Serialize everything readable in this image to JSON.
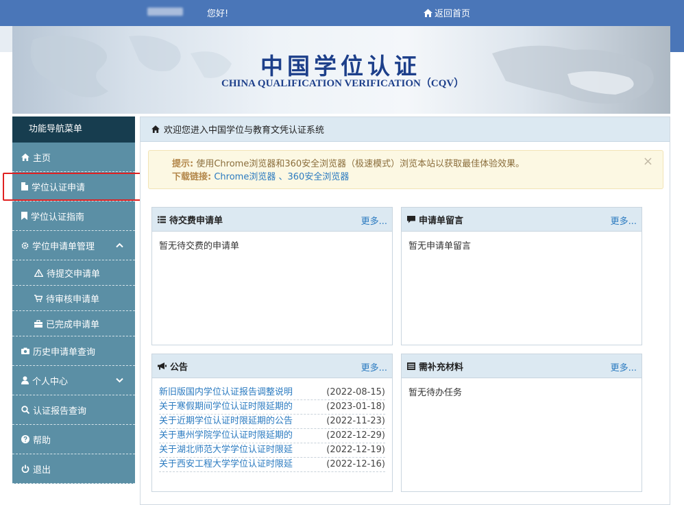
{
  "topbar": {
    "greeting": "您好!",
    "home_label": "返回首页"
  },
  "banner": {
    "title_cn": "中国学位认证",
    "title_en": "CHINA QUALIFICATION VERIFICATION（CQV）"
  },
  "sidebar": {
    "header": "功能导航菜单",
    "items": [
      {
        "label": "主页",
        "icon": "home-icon"
      },
      {
        "label": "学位认证申请",
        "icon": "file-icon"
      },
      {
        "label": "学位认证指南",
        "icon": "bookmark-icon"
      },
      {
        "label": "学位申请单管理",
        "icon": "gear-icon"
      },
      {
        "label": "待提交申请单",
        "icon": "warning-icon"
      },
      {
        "label": "待审核申请单",
        "icon": "cart-icon"
      },
      {
        "label": "已完成申请单",
        "icon": "briefcase-icon"
      },
      {
        "label": "历史申请单查询",
        "icon": "camera-icon"
      },
      {
        "label": "个人中心",
        "icon": "user-icon"
      },
      {
        "label": "认证报告查询",
        "icon": "search-icon"
      },
      {
        "label": "帮助",
        "icon": "help-icon"
      },
      {
        "label": "退出",
        "icon": "power-icon"
      }
    ]
  },
  "main": {
    "breadcrumb": "欢迎您进入中国学位与教育文凭认证系统",
    "alert": {
      "tip_label": "提示:",
      "tip_text": "使用Chrome浏览器和360安全浏览器（极速模式）浏览本站以获取最佳体验效果。",
      "download_label": "下载链接:",
      "link_chrome": "Chrome浏览器",
      "separator": "、",
      "link_360": "360安全浏览器",
      "close": "×"
    },
    "panels": {
      "pending_payment": {
        "title": "待交费申请单",
        "more": "更多...",
        "empty": "暂无待交费的申请单"
      },
      "messages": {
        "title": "申请单留言",
        "more": "更多...",
        "empty": "暂无申请单留言"
      },
      "notices": {
        "title": "公告",
        "more": "更多...",
        "items": [
          {
            "title": "新旧版国内学位认证报告调整说明",
            "date": "(2022-08-15)"
          },
          {
            "title": "关于寒假期间学位认证时限延期的",
            "date": "(2023-01-18)"
          },
          {
            "title": "关于近期学位认证时限延期的公告",
            "date": "(2022-11-23)"
          },
          {
            "title": "关于惠州学院学位认证时限延期的",
            "date": "(2022-12-29)"
          },
          {
            "title": "关于湖北师范大学学位认证时限延",
            "date": "(2022-12-19)"
          },
          {
            "title": "关于西安工程大学学位认证时限延",
            "date": "(2022-12-16)"
          }
        ]
      },
      "supplements": {
        "title": "需补充材料",
        "more": "更多...",
        "empty": "暂无待办任务"
      }
    }
  },
  "colors": {
    "topbar": "#4a76b8",
    "sidebar": "#5b8fa5",
    "sidebar_header": "#173d4f",
    "link": "#2a7ac0",
    "highlight": "#e02020"
  }
}
